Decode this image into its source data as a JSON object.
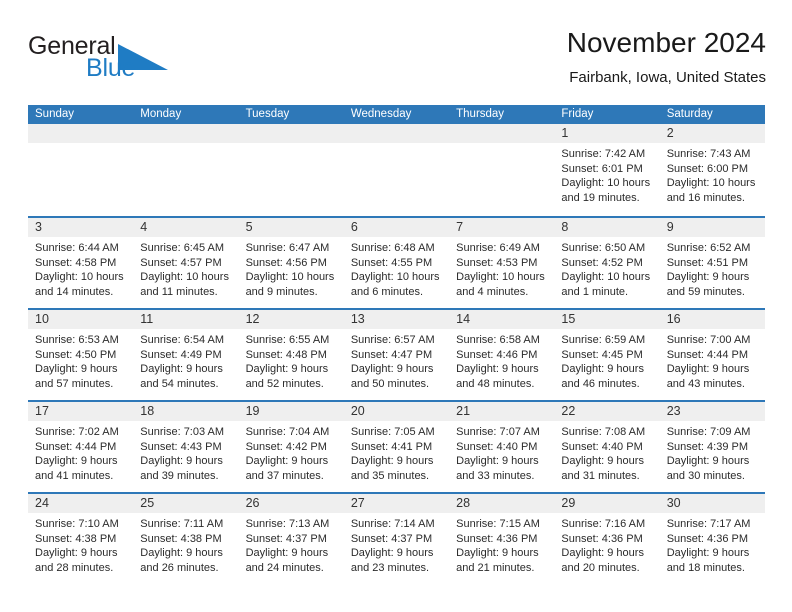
{
  "brand": {
    "name_part1": "General",
    "name_part2": "Blue",
    "accent_color": "#1f7cc4",
    "logo_icon": "blue-triangle-icon"
  },
  "header": {
    "title": "November 2024",
    "subtitle": "Fairbank, Iowa, United States"
  },
  "calendar": {
    "header_color": "#2e78b8",
    "weekdays": [
      "Sunday",
      "Monday",
      "Tuesday",
      "Wednesday",
      "Thursday",
      "Friday",
      "Saturday"
    ],
    "weeks": [
      [
        {
          "day": "",
          "sunrise": "",
          "sunset": "",
          "daylight1": "",
          "daylight2": ""
        },
        {
          "day": "",
          "sunrise": "",
          "sunset": "",
          "daylight1": "",
          "daylight2": ""
        },
        {
          "day": "",
          "sunrise": "",
          "sunset": "",
          "daylight1": "",
          "daylight2": ""
        },
        {
          "day": "",
          "sunrise": "",
          "sunset": "",
          "daylight1": "",
          "daylight2": ""
        },
        {
          "day": "",
          "sunrise": "",
          "sunset": "",
          "daylight1": "",
          "daylight2": ""
        },
        {
          "day": "1",
          "sunrise": "Sunrise: 7:42 AM",
          "sunset": "Sunset: 6:01 PM",
          "daylight1": "Daylight: 10 hours",
          "daylight2": "and 19 minutes."
        },
        {
          "day": "2",
          "sunrise": "Sunrise: 7:43 AM",
          "sunset": "Sunset: 6:00 PM",
          "daylight1": "Daylight: 10 hours",
          "daylight2": "and 16 minutes."
        }
      ],
      [
        {
          "day": "3",
          "sunrise": "Sunrise: 6:44 AM",
          "sunset": "Sunset: 4:58 PM",
          "daylight1": "Daylight: 10 hours",
          "daylight2": "and 14 minutes."
        },
        {
          "day": "4",
          "sunrise": "Sunrise: 6:45 AM",
          "sunset": "Sunset: 4:57 PM",
          "daylight1": "Daylight: 10 hours",
          "daylight2": "and 11 minutes."
        },
        {
          "day": "5",
          "sunrise": "Sunrise: 6:47 AM",
          "sunset": "Sunset: 4:56 PM",
          "daylight1": "Daylight: 10 hours",
          "daylight2": "and 9 minutes."
        },
        {
          "day": "6",
          "sunrise": "Sunrise: 6:48 AM",
          "sunset": "Sunset: 4:55 PM",
          "daylight1": "Daylight: 10 hours",
          "daylight2": "and 6 minutes."
        },
        {
          "day": "7",
          "sunrise": "Sunrise: 6:49 AM",
          "sunset": "Sunset: 4:53 PM",
          "daylight1": "Daylight: 10 hours",
          "daylight2": "and 4 minutes."
        },
        {
          "day": "8",
          "sunrise": "Sunrise: 6:50 AM",
          "sunset": "Sunset: 4:52 PM",
          "daylight1": "Daylight: 10 hours",
          "daylight2": "and 1 minute."
        },
        {
          "day": "9",
          "sunrise": "Sunrise: 6:52 AM",
          "sunset": "Sunset: 4:51 PM",
          "daylight1": "Daylight: 9 hours",
          "daylight2": "and 59 minutes."
        }
      ],
      [
        {
          "day": "10",
          "sunrise": "Sunrise: 6:53 AM",
          "sunset": "Sunset: 4:50 PM",
          "daylight1": "Daylight: 9 hours",
          "daylight2": "and 57 minutes."
        },
        {
          "day": "11",
          "sunrise": "Sunrise: 6:54 AM",
          "sunset": "Sunset: 4:49 PM",
          "daylight1": "Daylight: 9 hours",
          "daylight2": "and 54 minutes."
        },
        {
          "day": "12",
          "sunrise": "Sunrise: 6:55 AM",
          "sunset": "Sunset: 4:48 PM",
          "daylight1": "Daylight: 9 hours",
          "daylight2": "and 52 minutes."
        },
        {
          "day": "13",
          "sunrise": "Sunrise: 6:57 AM",
          "sunset": "Sunset: 4:47 PM",
          "daylight1": "Daylight: 9 hours",
          "daylight2": "and 50 minutes."
        },
        {
          "day": "14",
          "sunrise": "Sunrise: 6:58 AM",
          "sunset": "Sunset: 4:46 PM",
          "daylight1": "Daylight: 9 hours",
          "daylight2": "and 48 minutes."
        },
        {
          "day": "15",
          "sunrise": "Sunrise: 6:59 AM",
          "sunset": "Sunset: 4:45 PM",
          "daylight1": "Daylight: 9 hours",
          "daylight2": "and 46 minutes."
        },
        {
          "day": "16",
          "sunrise": "Sunrise: 7:00 AM",
          "sunset": "Sunset: 4:44 PM",
          "daylight1": "Daylight: 9 hours",
          "daylight2": "and 43 minutes."
        }
      ],
      [
        {
          "day": "17",
          "sunrise": "Sunrise: 7:02 AM",
          "sunset": "Sunset: 4:44 PM",
          "daylight1": "Daylight: 9 hours",
          "daylight2": "and 41 minutes."
        },
        {
          "day": "18",
          "sunrise": "Sunrise: 7:03 AM",
          "sunset": "Sunset: 4:43 PM",
          "daylight1": "Daylight: 9 hours",
          "daylight2": "and 39 minutes."
        },
        {
          "day": "19",
          "sunrise": "Sunrise: 7:04 AM",
          "sunset": "Sunset: 4:42 PM",
          "daylight1": "Daylight: 9 hours",
          "daylight2": "and 37 minutes."
        },
        {
          "day": "20",
          "sunrise": "Sunrise: 7:05 AM",
          "sunset": "Sunset: 4:41 PM",
          "daylight1": "Daylight: 9 hours",
          "daylight2": "and 35 minutes."
        },
        {
          "day": "21",
          "sunrise": "Sunrise: 7:07 AM",
          "sunset": "Sunset: 4:40 PM",
          "daylight1": "Daylight: 9 hours",
          "daylight2": "and 33 minutes."
        },
        {
          "day": "22",
          "sunrise": "Sunrise: 7:08 AM",
          "sunset": "Sunset: 4:40 PM",
          "daylight1": "Daylight: 9 hours",
          "daylight2": "and 31 minutes."
        },
        {
          "day": "23",
          "sunrise": "Sunrise: 7:09 AM",
          "sunset": "Sunset: 4:39 PM",
          "daylight1": "Daylight: 9 hours",
          "daylight2": "and 30 minutes."
        }
      ],
      [
        {
          "day": "24",
          "sunrise": "Sunrise: 7:10 AM",
          "sunset": "Sunset: 4:38 PM",
          "daylight1": "Daylight: 9 hours",
          "daylight2": "and 28 minutes."
        },
        {
          "day": "25",
          "sunrise": "Sunrise: 7:11 AM",
          "sunset": "Sunset: 4:38 PM",
          "daylight1": "Daylight: 9 hours",
          "daylight2": "and 26 minutes."
        },
        {
          "day": "26",
          "sunrise": "Sunrise: 7:13 AM",
          "sunset": "Sunset: 4:37 PM",
          "daylight1": "Daylight: 9 hours",
          "daylight2": "and 24 minutes."
        },
        {
          "day": "27",
          "sunrise": "Sunrise: 7:14 AM",
          "sunset": "Sunset: 4:37 PM",
          "daylight1": "Daylight: 9 hours",
          "daylight2": "and 23 minutes."
        },
        {
          "day": "28",
          "sunrise": "Sunrise: 7:15 AM",
          "sunset": "Sunset: 4:36 PM",
          "daylight1": "Daylight: 9 hours",
          "daylight2": "and 21 minutes."
        },
        {
          "day": "29",
          "sunrise": "Sunrise: 7:16 AM",
          "sunset": "Sunset: 4:36 PM",
          "daylight1": "Daylight: 9 hours",
          "daylight2": "and 20 minutes."
        },
        {
          "day": "30",
          "sunrise": "Sunrise: 7:17 AM",
          "sunset": "Sunset: 4:36 PM",
          "daylight1": "Daylight: 9 hours",
          "daylight2": "and 18 minutes."
        }
      ]
    ]
  }
}
